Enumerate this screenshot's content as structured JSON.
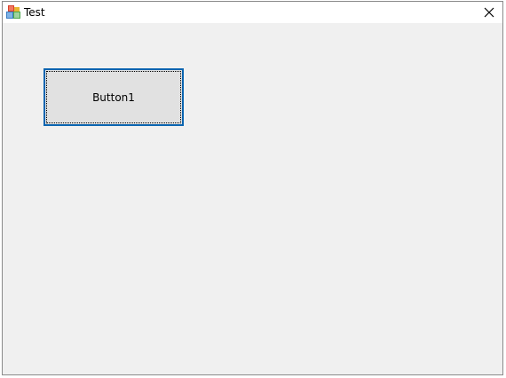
{
  "window": {
    "title": "Test",
    "app_icon": "windows-forms-app-icon",
    "close_icon": "close-icon",
    "accent_color": "#0a64b0",
    "background_color": "#f0f0f0"
  },
  "form": {
    "button1_label": "Button1"
  }
}
